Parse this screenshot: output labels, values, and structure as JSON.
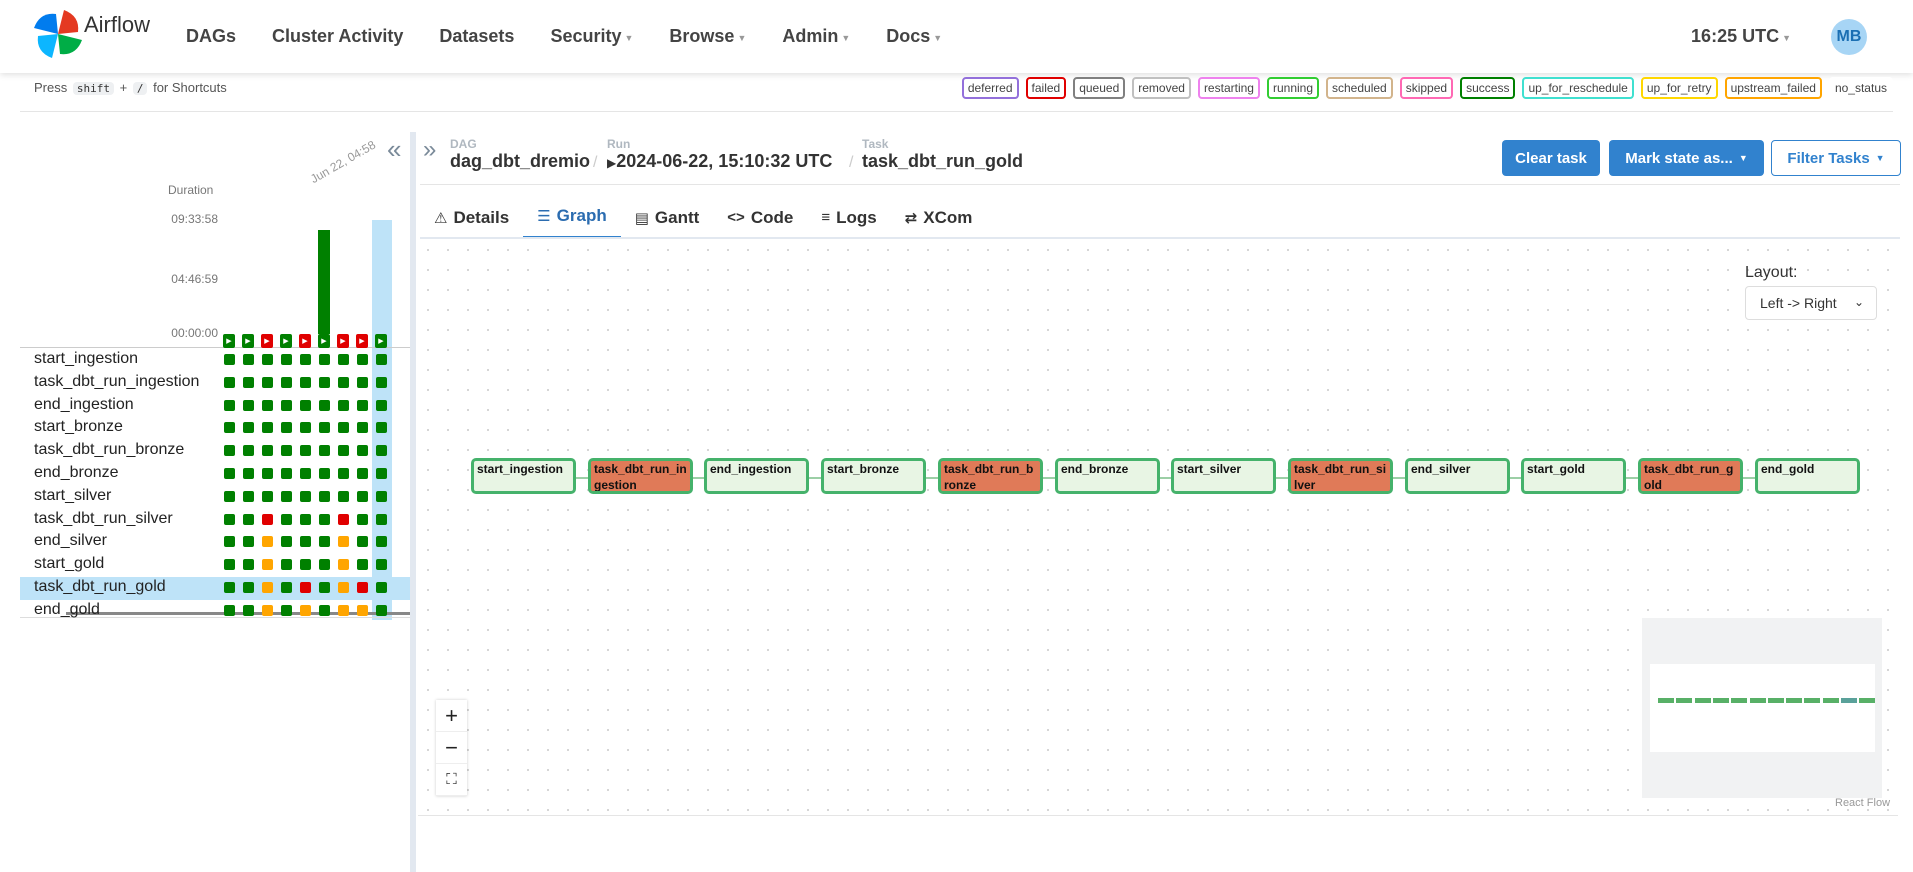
{
  "brand": {
    "name": "Airflow"
  },
  "nav": {
    "items": [
      {
        "label": "DAGs",
        "dropdown": false
      },
      {
        "label": "Cluster Activity",
        "dropdown": false
      },
      {
        "label": "Datasets",
        "dropdown": false
      },
      {
        "label": "Security",
        "dropdown": true
      },
      {
        "label": "Browse",
        "dropdown": true
      },
      {
        "label": "Admin",
        "dropdown": true
      },
      {
        "label": "Docs",
        "dropdown": true
      }
    ],
    "clock": "16:25 UTC",
    "avatar": "MB"
  },
  "shortcuts": {
    "press": "Press",
    "key1": "shift",
    "plus": "+",
    "key2": "/",
    "suffix": "for Shortcuts"
  },
  "legend": [
    {
      "label": "deferred",
      "color": "#9370db"
    },
    {
      "label": "failed",
      "color": "#e00000"
    },
    {
      "label": "queued",
      "color": "#808080"
    },
    {
      "label": "removed",
      "color": "#c0c0c0"
    },
    {
      "label": "restarting",
      "color": "#ee82ee"
    },
    {
      "label": "running",
      "color": "#32cd32"
    },
    {
      "label": "scheduled",
      "color": "#d2b48c"
    },
    {
      "label": "skipped",
      "color": "#ff69b4"
    },
    {
      "label": "success",
      "color": "#008000"
    },
    {
      "label": "up_for_reschedule",
      "color": "#40e0d0"
    },
    {
      "label": "up_for_retry",
      "color": "#ffd700"
    },
    {
      "label": "upstream_failed",
      "color": "#ffa500"
    },
    {
      "label": "no_status",
      "color": "transparent"
    }
  ],
  "grid": {
    "duration_label": "Duration",
    "ticks": [
      "09:33:58",
      "04:46:59",
      "00:00:00"
    ],
    "date_label": "Jun 22, 04:58",
    "runs": [
      {
        "state": "success",
        "duration_fraction": 0.0
      },
      {
        "state": "success",
        "duration_fraction": 0.0
      },
      {
        "state": "failed",
        "duration_fraction": 0.0
      },
      {
        "state": "success",
        "duration_fraction": 0.0
      },
      {
        "state": "failed",
        "duration_fraction": 0.0
      },
      {
        "state": "success",
        "duration_fraction": 1.0
      },
      {
        "state": "failed",
        "duration_fraction": 0.0
      },
      {
        "state": "failed",
        "duration_fraction": 0.0
      },
      {
        "state": "success",
        "duration_fraction": 0.0
      }
    ],
    "selected_run": 8,
    "tasks": [
      {
        "name": "start_ingestion",
        "states": [
          "s",
          "s",
          "s",
          "s",
          "s",
          "s",
          "s",
          "s",
          "s"
        ]
      },
      {
        "name": "task_dbt_run_ingestion",
        "states": [
          "s",
          "s",
          "s",
          "s",
          "s",
          "s",
          "s",
          "s",
          "s"
        ]
      },
      {
        "name": "end_ingestion",
        "states": [
          "s",
          "s",
          "s",
          "s",
          "s",
          "s",
          "s",
          "s",
          "s"
        ]
      },
      {
        "name": "start_bronze",
        "states": [
          "s",
          "s",
          "s",
          "s",
          "s",
          "s",
          "s",
          "s",
          "s"
        ]
      },
      {
        "name": "task_dbt_run_bronze",
        "states": [
          "s",
          "s",
          "s",
          "s",
          "s",
          "s",
          "s",
          "s",
          "s"
        ]
      },
      {
        "name": "end_bronze",
        "states": [
          "s",
          "s",
          "s",
          "s",
          "s",
          "s",
          "s",
          "s",
          "s"
        ]
      },
      {
        "name": "start_silver",
        "states": [
          "s",
          "s",
          "s",
          "s",
          "s",
          "s",
          "s",
          "s",
          "s"
        ]
      },
      {
        "name": "task_dbt_run_silver",
        "states": [
          "s",
          "s",
          "f",
          "s",
          "s",
          "s",
          "f",
          "s",
          "s"
        ]
      },
      {
        "name": "end_silver",
        "states": [
          "s",
          "s",
          "u",
          "s",
          "s",
          "s",
          "u",
          "s",
          "s"
        ]
      },
      {
        "name": "start_gold",
        "states": [
          "s",
          "s",
          "u",
          "s",
          "s",
          "s",
          "u",
          "s",
          "s"
        ]
      },
      {
        "name": "task_dbt_run_gold",
        "states": [
          "s",
          "s",
          "u",
          "s",
          "f",
          "s",
          "u",
          "f",
          "s"
        ]
      },
      {
        "name": "end_gold",
        "states": [
          "s",
          "s",
          "u",
          "s",
          "u",
          "s",
          "u",
          "u",
          "s"
        ]
      }
    ],
    "selected_task": 10,
    "state_colors": {
      "s": "#008000",
      "f": "#e00000",
      "u": "#ffa500"
    }
  },
  "breadcrumb": {
    "dag_label": "DAG",
    "dag": "dag_dbt_dremio",
    "run_label": "Run",
    "run": "2024-06-22, 15:10:32 UTC",
    "task_label": "Task",
    "task": "task_dbt_run_gold"
  },
  "actions": {
    "clear": "Clear task",
    "mark": "Mark state as...",
    "filter": "Filter Tasks"
  },
  "tabs": [
    {
      "label": "Details",
      "icon": "⚠",
      "active": false
    },
    {
      "label": "Graph",
      "icon": "☰",
      "active": true
    },
    {
      "label": "Gantt",
      "icon": "▤",
      "active": false
    },
    {
      "label": "Code",
      "icon": "<>",
      "active": false
    },
    {
      "label": "Logs",
      "icon": "≡",
      "active": false
    },
    {
      "label": "XCom",
      "icon": "⇄",
      "active": false
    }
  ],
  "graph": {
    "layout_label": "Layout:",
    "layout_value": "Left -> Right",
    "nodes": [
      {
        "name": "start_ingestion",
        "state": "success"
      },
      {
        "name": "task_dbt_run_ingestion",
        "state": "failed"
      },
      {
        "name": "end_ingestion",
        "state": "success"
      },
      {
        "name": "start_bronze",
        "state": "success"
      },
      {
        "name": "task_dbt_run_bronze",
        "state": "failed"
      },
      {
        "name": "end_bronze",
        "state": "success"
      },
      {
        "name": "start_silver",
        "state": "success"
      },
      {
        "name": "task_dbt_run_silver",
        "state": "failed"
      },
      {
        "name": "end_silver",
        "state": "success"
      },
      {
        "name": "start_gold",
        "state": "success"
      },
      {
        "name": "task_dbt_run_gold",
        "state": "failed"
      },
      {
        "name": "end_gold",
        "state": "success"
      }
    ],
    "zoom_in": "+",
    "zoom_out": "−",
    "fit_view": "⛶",
    "attribution": "React Flow"
  }
}
